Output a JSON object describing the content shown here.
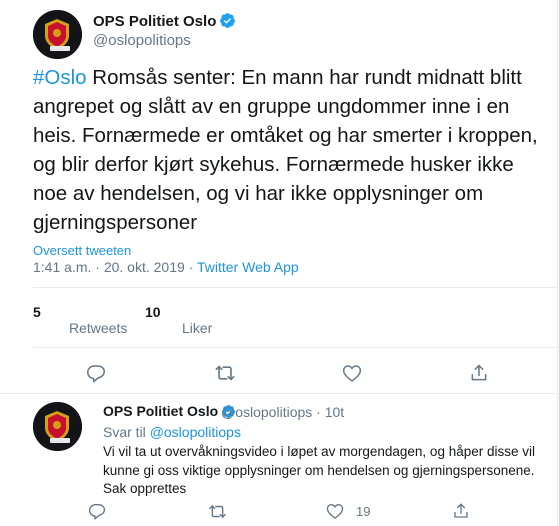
{
  "tweet": {
    "author_name": "OPS Politiet Oslo",
    "author_handle": "@oslopolitiops",
    "hashtag": "#Oslo",
    "text": " Romsås senter: En mann har rundt midnatt blitt angrepet og slått av en gruppe ungdommer inne i en heis. Fornærmede er omtåket og har smerter i kroppen, og blir derfor kjørt sykehus. Fornærmede husker ikke noe av hendelsen, og vi har ikke opplysninger om gjerningspersoner",
    "translate_label": "Oversett tweeten",
    "time": "1:41 a.m.",
    "separator": " · ",
    "date": "20. okt. 2019",
    "source": "Twitter Web App",
    "retweets_count": "5",
    "retweets_label": "Retweets",
    "likes_count": "10",
    "likes_label": "Liker"
  },
  "reply": {
    "author_name": "OPS Politiet Oslo",
    "author_handle": "@oslopolitiops · 10t",
    "reply_prefix": "Svar til ",
    "reply_mention": "@oslopolitiops",
    "text": "Vi vil ta ut overvåkningsvideo i løpet av morgendagen, og håper disse vil kunne gi oss viktige opplysninger om hendelsen og gjerningspersonene. Sak opprettes",
    "likes_count": "19"
  },
  "icons": {
    "reply": "reply-icon",
    "retweet": "retweet-icon",
    "like": "heart-icon",
    "share": "share-icon",
    "verified": "verified-badge-icon"
  },
  "colors": {
    "accent": "#1b95e0",
    "secondary_text": "#657786",
    "primary_text": "#14171a",
    "divider": "#e6ecf0",
    "avatar_bg": "#121418",
    "badge_red": "#c8102e",
    "badge_gold": "#d4a017"
  }
}
